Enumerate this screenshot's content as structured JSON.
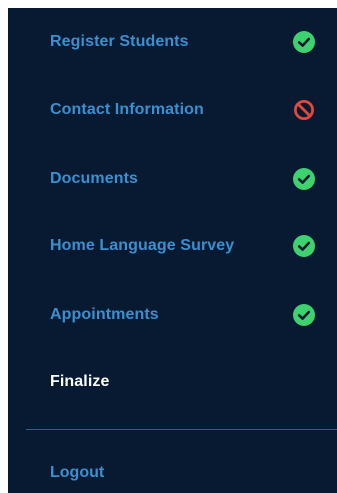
{
  "colors": {
    "background": "#071a31",
    "link": "#3a8fd0",
    "active": "#ffffff",
    "complete": "#3dd16f",
    "blocked": "#e0493e",
    "divider": "#2d5f8b"
  },
  "nav": {
    "items": [
      {
        "label": "Register Students",
        "status": "complete",
        "icon": "check-circle-icon"
      },
      {
        "label": "Contact Information",
        "status": "blocked",
        "icon": "blocked-icon"
      },
      {
        "label": "Documents",
        "status": "complete",
        "icon": "check-circle-icon"
      },
      {
        "label": "Home Language Survey",
        "status": "complete",
        "icon": "check-circle-icon"
      },
      {
        "label": "Appointments",
        "status": "complete",
        "icon": "check-circle-icon"
      },
      {
        "label": "Finalize",
        "status": "current",
        "icon": ""
      }
    ],
    "logout_label": "Logout"
  }
}
